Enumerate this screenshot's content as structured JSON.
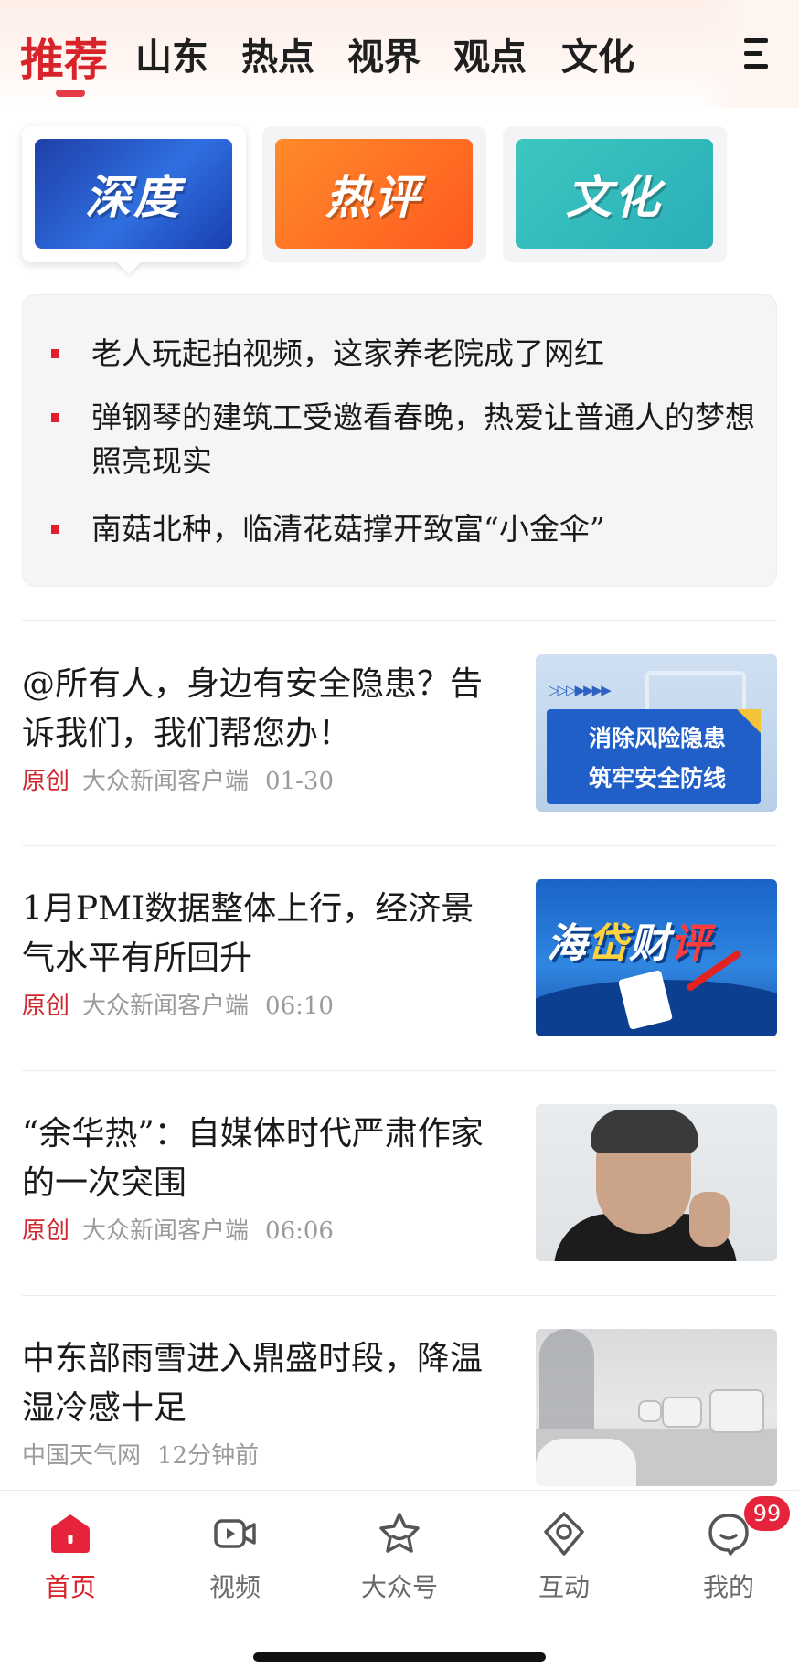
{
  "top_tabs": [
    {
      "label": "推荐",
      "active": true
    },
    {
      "label": "山东"
    },
    {
      "label": "热点"
    },
    {
      "label": "视界"
    },
    {
      "label": "观点"
    },
    {
      "label": "文化"
    }
  ],
  "menu_icon": "hamburger-menu-icon",
  "channel_cards": [
    {
      "label": "深度",
      "selected": true,
      "color": "#2a5fd6"
    },
    {
      "label": "热评",
      "color": "#ff6a22"
    },
    {
      "label": "文化",
      "color": "#34bfc0"
    }
  ],
  "headlines": [
    "老人玩起拍视频，这家养老院成了网红",
    "弹钢琴的建筑工受邀看春晚，热爱让普通人的梦想照亮现实",
    "南菇北种，临清花菇撑开致富“小金伞”"
  ],
  "news": [
    {
      "title": "@所有人，身边有安全隐患？告诉我们，我们帮您办！",
      "tag": "原创",
      "source": "大众新闻客户端",
      "time": "01-30",
      "thumb_text": [
        "消除风险隐患",
        "筑牢安全防线"
      ]
    },
    {
      "title": "1月PMI数据整体上行，经济景气水平有所回升",
      "tag": "原创",
      "source": "大众新闻客户端",
      "time": "06:10",
      "thumb_text": [
        "海",
        "岱",
        "财",
        "评"
      ]
    },
    {
      "title": "“余华热”：自媒体时代严肃作家的一次突围",
      "tag": "原创",
      "source": "大众新闻客户端",
      "time": "06:06"
    },
    {
      "title": "中东部雨雪进入鼎盛时段，降温湿冷感十足",
      "source": "中国天气网",
      "time": "12分钟前"
    }
  ],
  "bottom_nav": [
    {
      "label": "首页",
      "icon": "home-icon",
      "active": true
    },
    {
      "label": "视频",
      "icon": "video-camera-icon"
    },
    {
      "label": "大众号",
      "icon": "star-icon"
    },
    {
      "label": "互动",
      "icon": "location-pin-icon"
    },
    {
      "label": "我的",
      "icon": "chat-face-icon"
    }
  ],
  "notification_count": "99",
  "colors": {
    "accent": "#d8232a",
    "badge": "#e5233a"
  }
}
